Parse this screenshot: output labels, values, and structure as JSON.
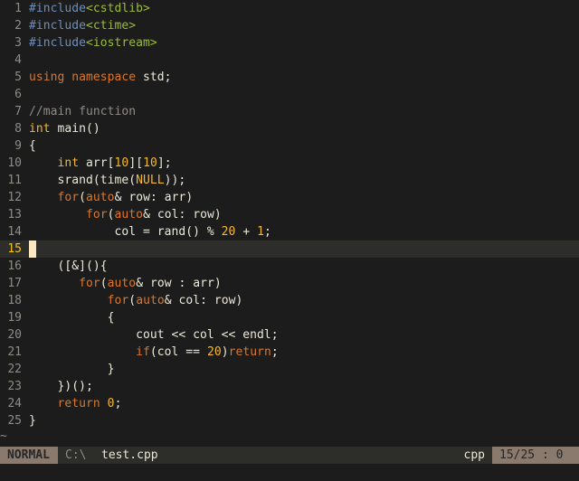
{
  "editor": {
    "current_line": 15,
    "lines": [
      {
        "n": "1",
        "tokens": [
          {
            "t": "pre",
            "v": "#include"
          },
          {
            "t": "inc",
            "v": "<cstdlib>"
          }
        ]
      },
      {
        "n": "2",
        "tokens": [
          {
            "t": "pre",
            "v": "#include"
          },
          {
            "t": "inc",
            "v": "<ctime>"
          }
        ]
      },
      {
        "n": "3",
        "tokens": [
          {
            "t": "pre",
            "v": "#include"
          },
          {
            "t": "inc",
            "v": "<iostream>"
          }
        ]
      },
      {
        "n": "4",
        "tokens": []
      },
      {
        "n": "5",
        "tokens": [
          {
            "t": "kw",
            "v": "using namespace"
          },
          {
            "t": "plain",
            "v": " std;"
          }
        ]
      },
      {
        "n": "6",
        "tokens": []
      },
      {
        "n": "7",
        "tokens": [
          {
            "t": "cmt",
            "v": "//main function"
          }
        ]
      },
      {
        "n": "8",
        "tokens": [
          {
            "t": "num",
            "v": "int"
          },
          {
            "t": "plain",
            "v": " main()"
          }
        ]
      },
      {
        "n": "9",
        "tokens": [
          {
            "t": "plain",
            "v": "{"
          }
        ]
      },
      {
        "n": "10",
        "tokens": [
          {
            "t": "plain",
            "v": "    "
          },
          {
            "t": "num",
            "v": "int"
          },
          {
            "t": "plain",
            "v": " arr["
          },
          {
            "t": "num",
            "v": "10"
          },
          {
            "t": "plain",
            "v": "]["
          },
          {
            "t": "num",
            "v": "10"
          },
          {
            "t": "plain",
            "v": "];"
          }
        ]
      },
      {
        "n": "11",
        "tokens": [
          {
            "t": "plain",
            "v": "    srand(time("
          },
          {
            "t": "num",
            "v": "NULL"
          },
          {
            "t": "plain",
            "v": "));"
          }
        ]
      },
      {
        "n": "12",
        "tokens": [
          {
            "t": "plain",
            "v": "    "
          },
          {
            "t": "kw",
            "v": "for"
          },
          {
            "t": "plain",
            "v": "("
          },
          {
            "t": "kw",
            "v": "auto"
          },
          {
            "t": "plain",
            "v": "& row: arr)"
          }
        ]
      },
      {
        "n": "13",
        "tokens": [
          {
            "t": "plain",
            "v": "        "
          },
          {
            "t": "kw",
            "v": "for"
          },
          {
            "t": "plain",
            "v": "("
          },
          {
            "t": "kw",
            "v": "auto"
          },
          {
            "t": "plain",
            "v": "& col: row)"
          }
        ]
      },
      {
        "n": "14",
        "tokens": [
          {
            "t": "plain",
            "v": "            col = rand() % "
          },
          {
            "t": "num",
            "v": "20"
          },
          {
            "t": "plain",
            "v": " + "
          },
          {
            "t": "num",
            "v": "1"
          },
          {
            "t": "plain",
            "v": ";"
          }
        ]
      },
      {
        "n": "15",
        "tokens": []
      },
      {
        "n": "16",
        "tokens": [
          {
            "t": "plain",
            "v": "    ([&](){"
          }
        ]
      },
      {
        "n": "17",
        "tokens": [
          {
            "t": "plain",
            "v": "       "
          },
          {
            "t": "kw",
            "v": "for"
          },
          {
            "t": "plain",
            "v": "("
          },
          {
            "t": "kw",
            "v": "auto"
          },
          {
            "t": "plain",
            "v": "& row : arr)"
          }
        ]
      },
      {
        "n": "18",
        "tokens": [
          {
            "t": "plain",
            "v": "           "
          },
          {
            "t": "kw",
            "v": "for"
          },
          {
            "t": "plain",
            "v": "("
          },
          {
            "t": "kw",
            "v": "auto"
          },
          {
            "t": "plain",
            "v": "& col: row)"
          }
        ]
      },
      {
        "n": "19",
        "tokens": [
          {
            "t": "plain",
            "v": "           {"
          }
        ]
      },
      {
        "n": "20",
        "tokens": [
          {
            "t": "plain",
            "v": "               cout << col << endl;"
          }
        ]
      },
      {
        "n": "21",
        "tokens": [
          {
            "t": "plain",
            "v": "               "
          },
          {
            "t": "kw",
            "v": "if"
          },
          {
            "t": "plain",
            "v": "(col == "
          },
          {
            "t": "num",
            "v": "20"
          },
          {
            "t": "plain",
            "v": ")"
          },
          {
            "t": "kw",
            "v": "return"
          },
          {
            "t": "plain",
            "v": ";"
          }
        ]
      },
      {
        "n": "22",
        "tokens": [
          {
            "t": "plain",
            "v": "           }"
          }
        ]
      },
      {
        "n": "23",
        "tokens": [
          {
            "t": "plain",
            "v": "    })();"
          }
        ]
      },
      {
        "n": "24",
        "tokens": [
          {
            "t": "plain",
            "v": "    "
          },
          {
            "t": "kw",
            "v": "return"
          },
          {
            "t": "plain",
            "v": " "
          },
          {
            "t": "num",
            "v": "0"
          },
          {
            "t": "plain",
            "v": ";"
          }
        ]
      },
      {
        "n": "25",
        "tokens": [
          {
            "t": "plain",
            "v": "}"
          }
        ]
      }
    ],
    "end_of_buffer_marker": "~"
  },
  "statusbar": {
    "mode": "NORMAL",
    "path": "C:\\",
    "filename": "test.cpp",
    "filetype": "cpp",
    "position": "15/25 : 0"
  },
  "colors": {
    "background": "#1c1c1c",
    "cursorline": "#2d2d2a",
    "keyword": "#d9782d",
    "number": "#f5b92c",
    "preproc": "#6a8fbf",
    "include": "#9cba3a",
    "comment": "#8f8c85",
    "mode_badge": "#8a7a6e"
  }
}
